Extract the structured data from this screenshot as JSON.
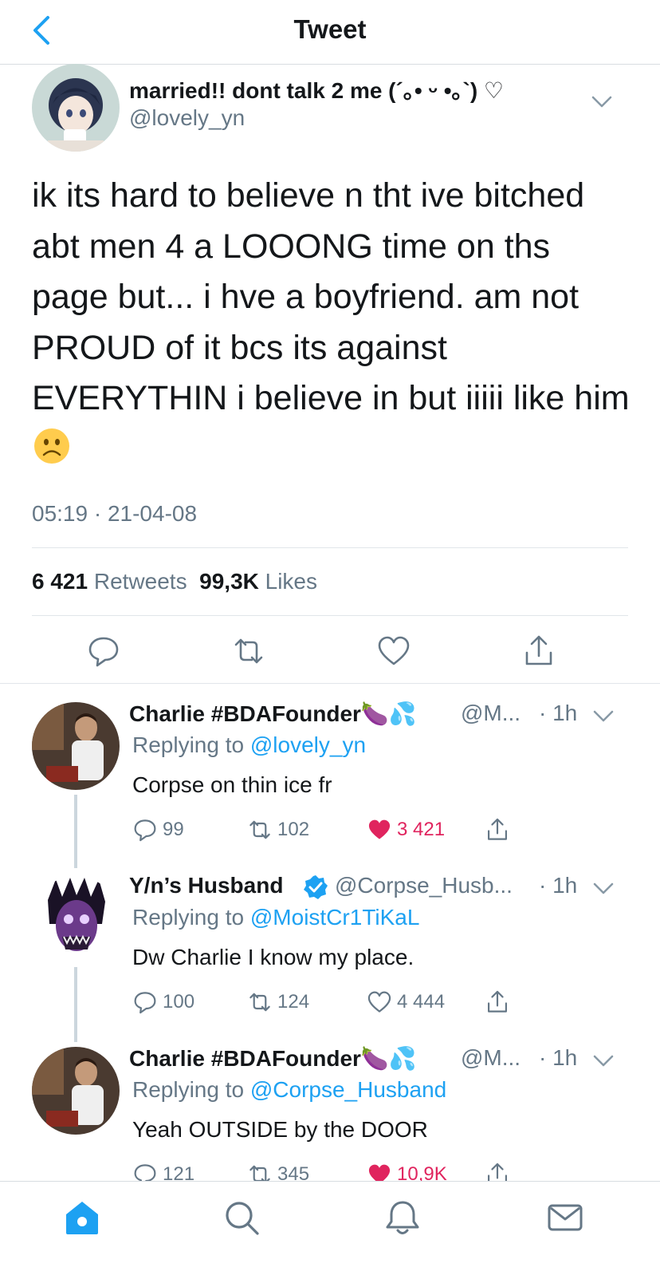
{
  "header": {
    "title": "Tweet"
  },
  "tweet": {
    "display_name": "married!! dont talk 2 me (´｡• ᵕ •｡`) ♡",
    "handle": "@lovely_yn",
    "text": "ik its hard to believe n tht ive bitched\nabt men 4 a LOOONG time on ths\npage but... i hve a boyfriend. am not\nPROUD of it bcs its against\nEVERYTHIN i believe in but iiiii like him",
    "emoji": "frowning-face",
    "timestamp": "05:19 · 21-04-08",
    "retweets_count": "6 421",
    "retweets_label": "Retweets",
    "likes_count": "99,3K",
    "likes_label": "Likes"
  },
  "replies": [
    {
      "display_name": "Charlie #BDAFounder🍆💦",
      "handle": "@M...",
      "time": "· 1h",
      "replying_prefix": "Replying to",
      "replying_to": "@lovely_yn",
      "text": "Corpse on thin ice fr",
      "comments": "99",
      "retweets": "102",
      "likes": "3 421",
      "liked": true
    },
    {
      "display_name": "Y/n’s Husband",
      "handle": "@Corpse_Husb...",
      "time": "· 1h",
      "replying_prefix": "Replying to",
      "replying_to": "@MoistCr1TiKaL",
      "text": "Dw Charlie I know my place.",
      "comments": "100",
      "retweets": "124",
      "likes": "4 444",
      "liked": false
    },
    {
      "display_name": "Charlie #BDAFounder🍆💦",
      "handle": "@M...",
      "time": "· 1h",
      "replying_prefix": "Replying to",
      "replying_to": "@Corpse_Husband",
      "text": "Yeah OUTSIDE by the DOOR",
      "comments": "121",
      "retweets": "345",
      "likes": "10,9K",
      "liked": true
    }
  ],
  "tabbar": {
    "tabs": [
      "home-icon",
      "search-icon",
      "notifications-icon",
      "messages-icon"
    ]
  },
  "colors": {
    "accent": "#1da1f2",
    "like": "#e0245e",
    "muted": "#657786",
    "verified": "#1da1f2"
  }
}
